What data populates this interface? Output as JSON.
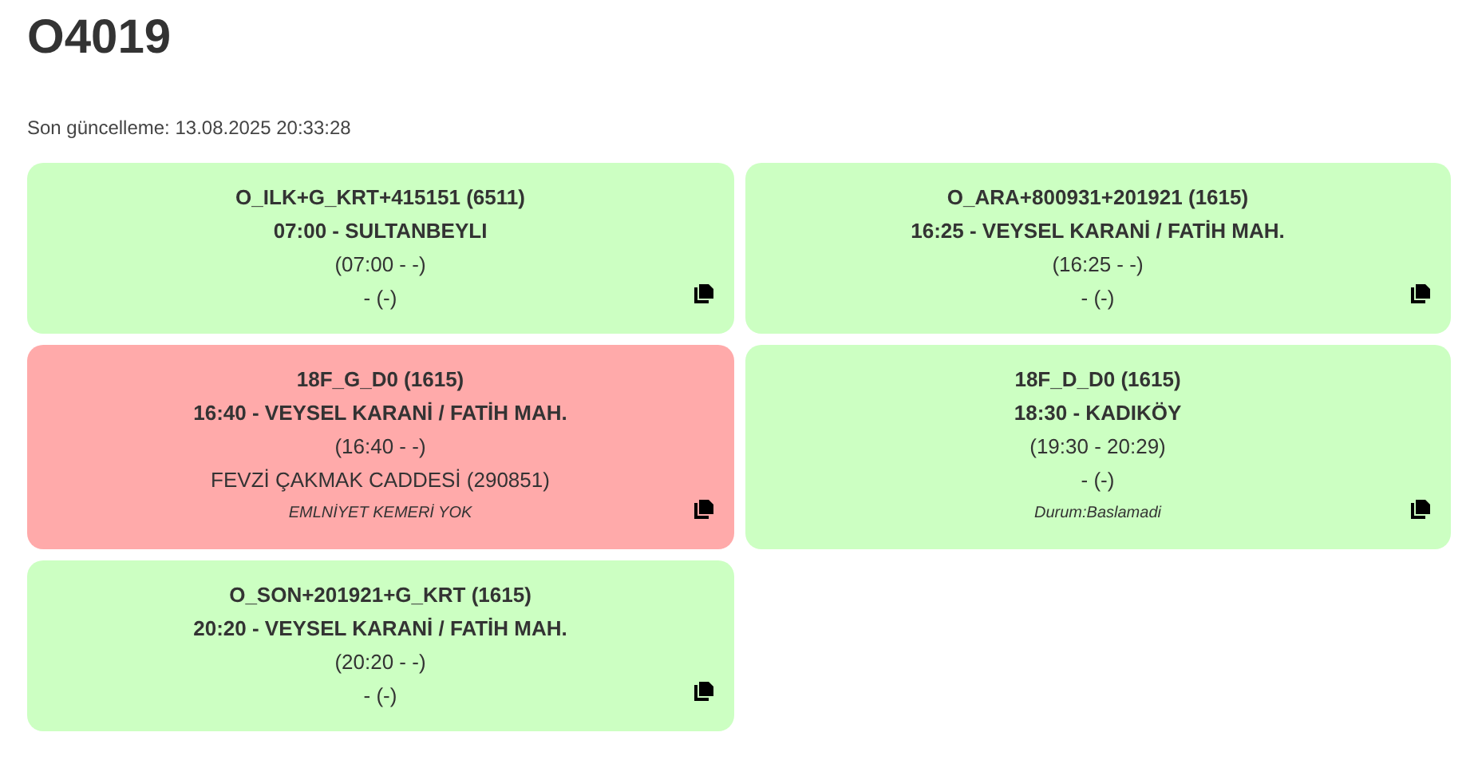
{
  "title": "O4019",
  "last_update": "Son güncelleme: 13.08.2025 20:33:28",
  "cards": [
    {
      "color": "#ccffc2",
      "code": "O_ILK+G_KRT+415151 (6511)",
      "route": "07:00 - SULTANBEYLI",
      "times": "(07:00 - -)",
      "location": "- (-)"
    },
    {
      "color": "#ccffc2",
      "code": "O_ARA+800931+201921 (1615)",
      "route": "16:25 - VEYSEL KARANİ / FATİH MAH.",
      "times": "(16:25 - -)",
      "location": "- (-)"
    },
    {
      "color": "#ffaaaa",
      "code": "18F_G_D0 (1615)",
      "route": "16:40 - VEYSEL KARANİ / FATİH MAH.",
      "times": "(16:40 - -)",
      "location": "FEVZİ ÇAKMAK CADDESİ (290851)",
      "note": "EMLNİYET KEMERİ YOK"
    },
    {
      "color": "#ccffc2",
      "code": "18F_D_D0 (1615)",
      "route": "18:30 - KADIKÖY",
      "times": "(19:30 - 20:29)",
      "location": "- (-)",
      "note": "Durum:Baslamadi"
    },
    {
      "color": "#ccffc2",
      "code": "O_SON+201921+G_KRT (1615)",
      "route": "20:20 - VEYSEL KARANİ / FATİH MAH.",
      "times": "(20:20 - -)",
      "location": "- (-)"
    }
  ]
}
